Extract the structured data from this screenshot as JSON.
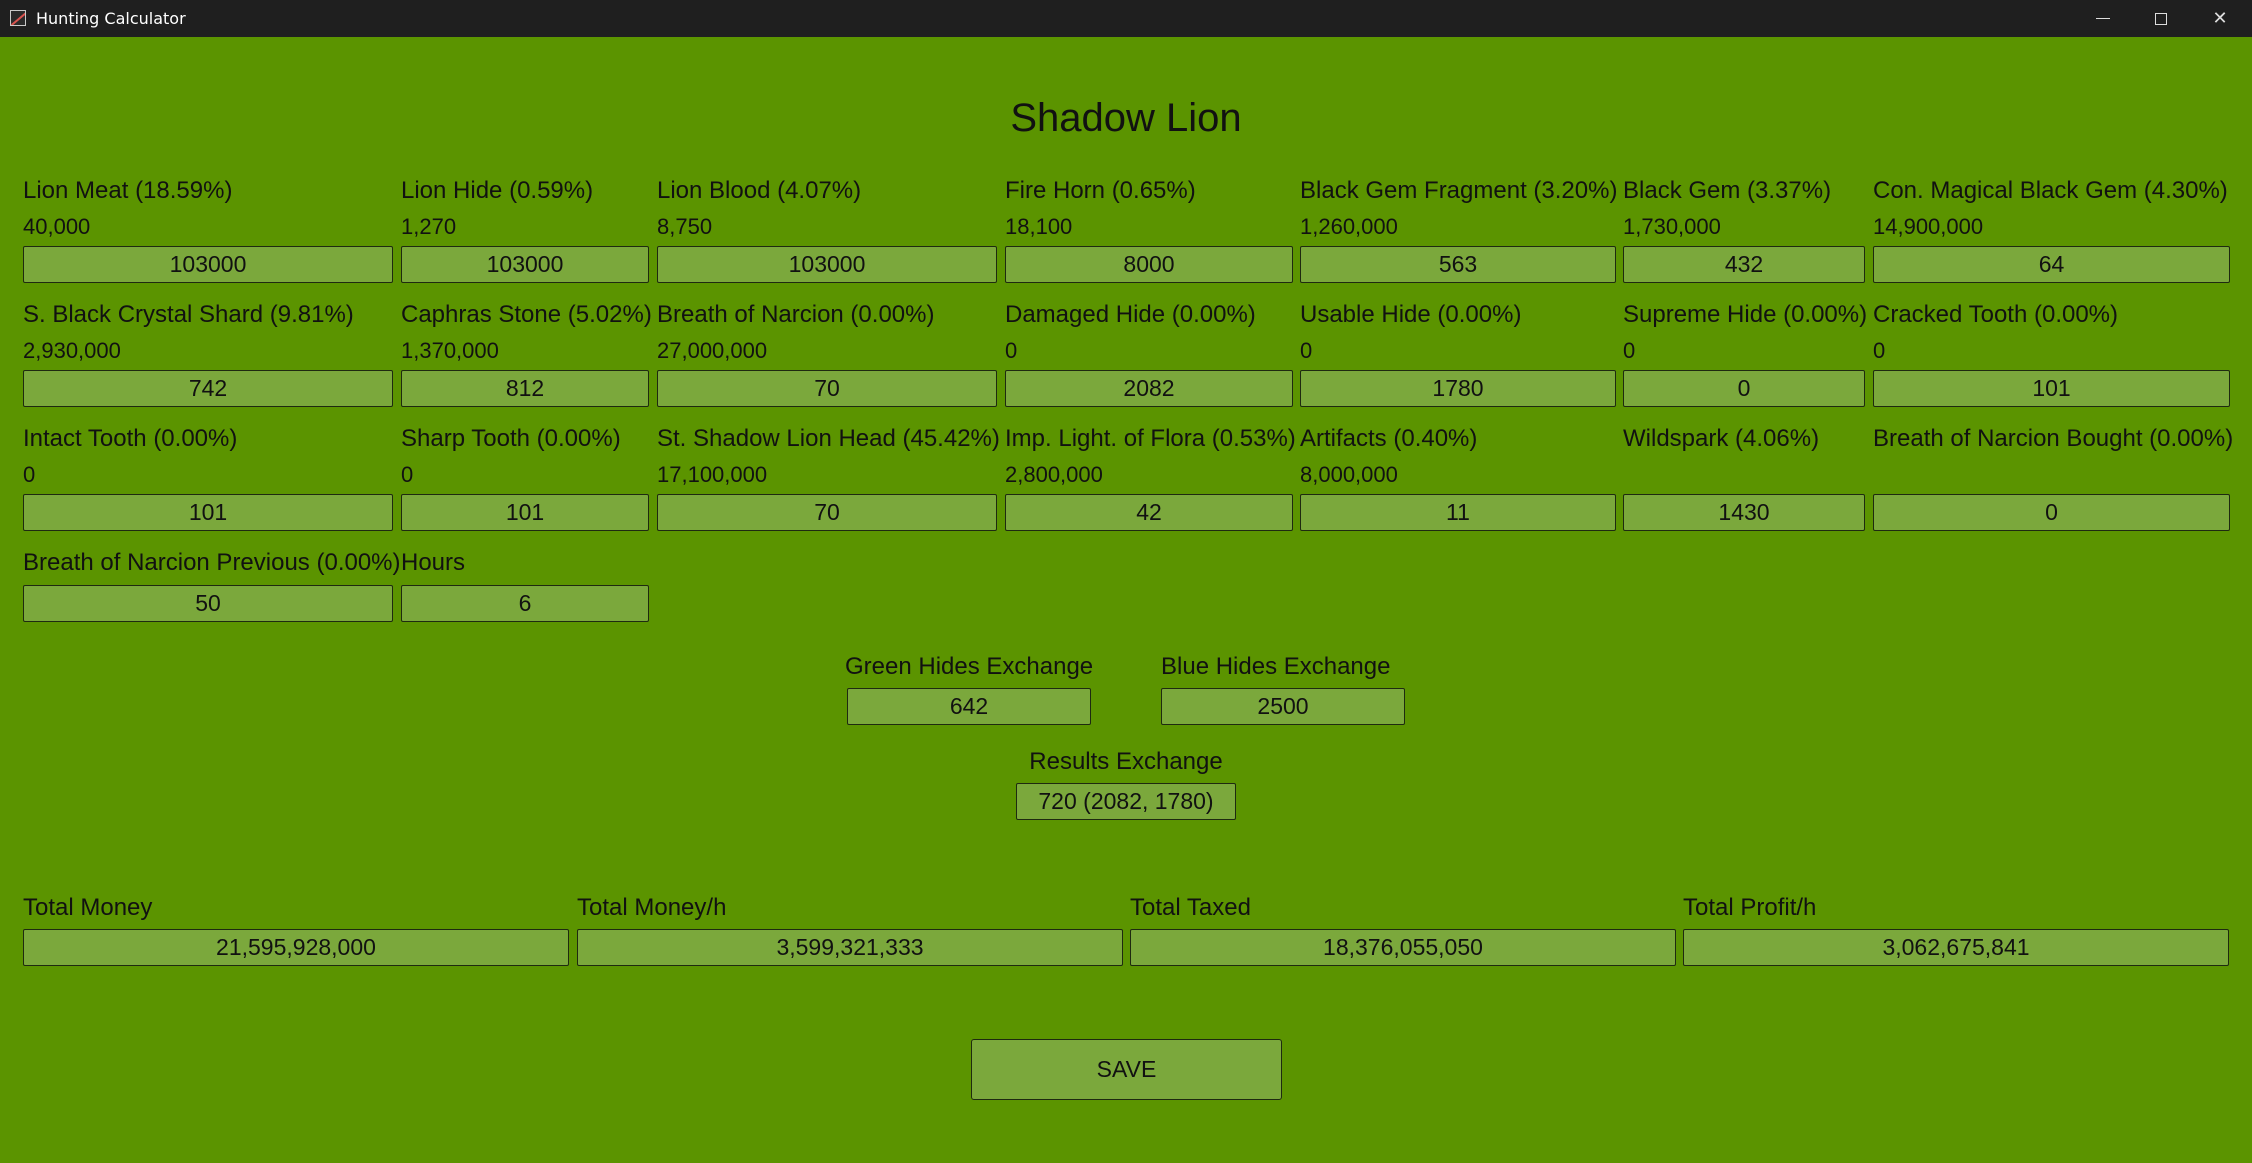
{
  "window": {
    "title": "Hunting Calculator"
  },
  "page_title": "Shadow Lion",
  "items": [
    {
      "label": "Lion Meat (18.59%)",
      "price": "40,000",
      "value": "103000"
    },
    {
      "label": "Lion Hide (0.59%)",
      "price": "1,270",
      "value": "103000"
    },
    {
      "label": "Lion Blood (4.07%)",
      "price": "8,750",
      "value": "103000"
    },
    {
      "label": "Fire Horn (0.65%)",
      "price": "18,100",
      "value": "8000"
    },
    {
      "label": "Black Gem Fragment (3.20%)",
      "price": "1,260,000",
      "value": "563"
    },
    {
      "label": "Black Gem (3.37%)",
      "price": "1,730,000",
      "value": "432"
    },
    {
      "label": "Con. Magical Black Gem (4.30%)",
      "price": "14,900,000",
      "value": "64"
    },
    {
      "label": "S. Black Crystal Shard (9.81%)",
      "price": "2,930,000",
      "value": "742"
    },
    {
      "label": "Caphras Stone (5.02%)",
      "price": "1,370,000",
      "value": "812"
    },
    {
      "label": "Breath of Narcion (0.00%)",
      "price": "27,000,000",
      "value": "70"
    },
    {
      "label": "Damaged Hide (0.00%)",
      "price": "0",
      "value": "2082"
    },
    {
      "label": "Usable Hide (0.00%)",
      "price": "0",
      "value": "1780"
    },
    {
      "label": "Supreme Hide (0.00%)",
      "price": "0",
      "value": "0"
    },
    {
      "label": "Cracked Tooth (0.00%)",
      "price": "0",
      "value": "101"
    },
    {
      "label": "Intact Tooth (0.00%)",
      "price": "0",
      "value": "101"
    },
    {
      "label": "Sharp Tooth (0.00%)",
      "price": "0",
      "value": "101"
    },
    {
      "label": "St. Shadow Lion Head (45.42%)",
      "price": "17,100,000",
      "value": "70"
    },
    {
      "label": "Imp. Light. of Flora (0.53%)",
      "price": "2,800,000",
      "value": "42"
    },
    {
      "label": "Artifacts (0.40%)",
      "price": "8,000,000",
      "value": "11"
    },
    {
      "label": "Wildspark (4.06%)",
      "price": "",
      "value": "1430"
    },
    {
      "label": "Breath of Narcion Bought (0.00%)",
      "price": "",
      "value": "0"
    },
    {
      "label": "Breath of Narcion Previous (0.00%)",
      "price": "",
      "value": "50"
    },
    {
      "label": "Hours",
      "price": "",
      "value": "6"
    }
  ],
  "exchange": {
    "green_label": "Green Hides Exchange",
    "green_value": "642",
    "blue_label": "Blue Hides Exchange",
    "blue_value": "2500",
    "results_label": "Results Exchange",
    "results_value": "720 (2082, 1780)"
  },
  "totals": [
    {
      "label": "Total Money",
      "value": "21,595,928,000"
    },
    {
      "label": "Total Money/h",
      "value": "3,599,321,333"
    },
    {
      "label": "Total Taxed",
      "value": "18,376,055,050"
    },
    {
      "label": "Total Profit/h",
      "value": "3,062,675,841"
    }
  ],
  "save_label": "SAVE",
  "colors": {
    "background": "#5b9400",
    "field": "#7ba83c",
    "titlebar": "#1f1f1f"
  },
  "icons": {
    "app": "app-icon",
    "minimize": "minimize-icon",
    "maximize": "maximize-icon",
    "close": "close-icon"
  }
}
